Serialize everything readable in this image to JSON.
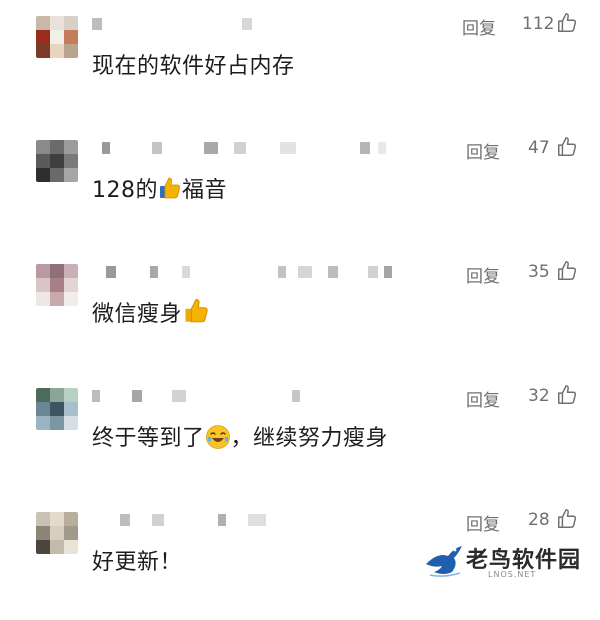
{
  "comments": [
    {
      "reply_label": "回复",
      "likes": "112",
      "text": "现在的软件好占内存"
    },
    {
      "reply_label": "回复",
      "likes": "47",
      "text_before": "128的",
      "emoji": "thumbs-up",
      "text_after": "福音"
    },
    {
      "reply_label": "回复",
      "likes": "35",
      "text_before": "微信瘦身",
      "emoji": "thumbs-up",
      "text_after": ""
    },
    {
      "reply_label": "回复",
      "likes": "32",
      "text_before": "终于等到了",
      "emoji": "laughing-face",
      "text_after": "，继续努力瘦身"
    },
    {
      "reply_label": "回复",
      "likes": "28",
      "text": "好更新！"
    }
  ],
  "watermark": {
    "title": "老鸟软件园",
    "subtitle": "LNOS.NET"
  },
  "colors": {
    "meta_gray": "#6f6f6f",
    "text": "#1d1d1d",
    "thumb_yellow": "#f5b301"
  }
}
